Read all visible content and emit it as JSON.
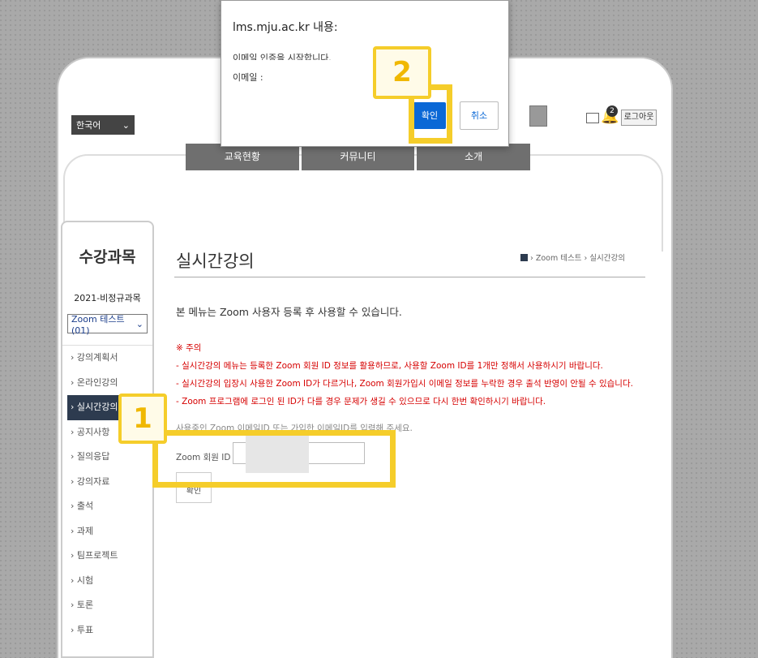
{
  "header": {
    "language": "한국어",
    "notification_count": "2",
    "logout_label": "로그아웃"
  },
  "gnb": [
    "교육현황",
    "커뮤니티",
    "소개"
  ],
  "sidebar": {
    "title": "수강과목",
    "term": "2021-비정규과목",
    "course_select": "Zoom 테스트(01)",
    "items": [
      {
        "label": "› 강의계획서"
      },
      {
        "label": "› 온라인강의"
      },
      {
        "label": "› 실시간강의"
      },
      {
        "label": "› 공지사항"
      },
      {
        "label": "› 질의응답"
      },
      {
        "label": "› 강의자료"
      },
      {
        "label": "› 출석"
      },
      {
        "label": "› 과제"
      },
      {
        "label": "› 팀프로젝트"
      },
      {
        "label": "› 시험"
      },
      {
        "label": "› 토론"
      },
      {
        "label": "› 투표"
      }
    ]
  },
  "main": {
    "title": "실시간강의",
    "breadcrumb": "› Zoom 테스트 › 실시간강의",
    "intro": "본 메뉴는 Zoom 사용자 등록 후 사용할 수 있습니다.",
    "notice_heading": "※ 주의",
    "notices": [
      "- 실시간강의 메뉴는 등록한 Zoom 회원 ID 정보를 활용하므로, 사용할 Zoom ID를 1개만 정해서 사용하시기 바랍니다.",
      "- 실시간강의 입장시 사용한 Zoom ID가 다르거나, Zoom 회원가입시 이메일 정보를 누락한 경우 출석 반영이 안될 수 있습니다.",
      "- Zoom 프로그램에 로그인 된 ID가 다를 경우 문제가 생길 수 있으므로 다시 한번 확인하시기 바랍니다."
    ],
    "guide": "사용중인 Zoom 이메일ID 또는 가입한 이메일ID를 입력해 주세요.",
    "zoom_label": "Zoom 회원 ID :",
    "submit_label": "확인"
  },
  "dialog": {
    "title": "lms.mju.ac.kr 내용:",
    "line1": "이메일 인증을 시작합니다.",
    "line2": "이메일 :",
    "ok_label": "확인",
    "cancel_label": "취소"
  },
  "callouts": {
    "step1": "1",
    "step2": "2"
  },
  "colors": {
    "accent": "#0a68d6",
    "highlight": "#f5cd2a",
    "warning": "#d60000"
  }
}
